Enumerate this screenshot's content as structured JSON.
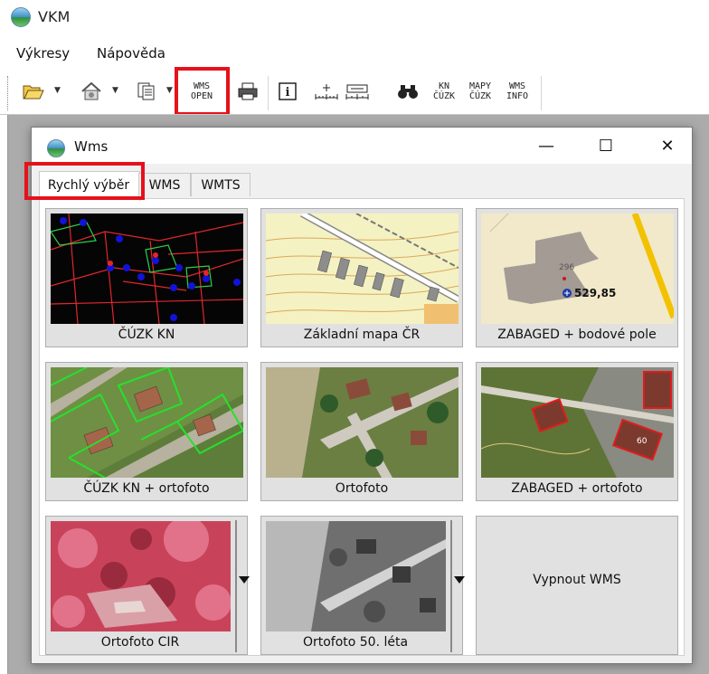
{
  "app": {
    "title": "VKM"
  },
  "menu": {
    "items": [
      "Výkresy",
      "Nápověda"
    ]
  },
  "toolbar": {
    "wms_open": "WMS\nOPEN",
    "kn_cuzk": "KN\nČÚZK",
    "mapy_cuzk": "MAPY\nČÚZK",
    "wms_info": "WMS\nINFO"
  },
  "dialog": {
    "title": "Wms",
    "minimize": "—",
    "maximize": "☐",
    "close": "✕",
    "tabs": [
      "Rychlý výběr",
      "WMS",
      "WMTS"
    ]
  },
  "tiles": [
    {
      "label": "ČÚZK KN"
    },
    {
      "label": "Základní mapa ČR"
    },
    {
      "label": "ZABAGED + bodové pole",
      "thumb_text": "296",
      "thumb_value": "529,85"
    },
    {
      "label": "ČÚZK KN + ortofoto"
    },
    {
      "label": "Ortofoto"
    },
    {
      "label": "ZABAGED + ortofoto",
      "thumb_text": "60"
    },
    {
      "label": "Ortofoto CIR"
    },
    {
      "label": "Ortofoto 50. léta"
    },
    {
      "label": "Vypnout WMS"
    }
  ],
  "colors": {
    "highlight": "#e6111b",
    "workspace": "#ababab",
    "tile_bg": "#e1e1e1"
  }
}
